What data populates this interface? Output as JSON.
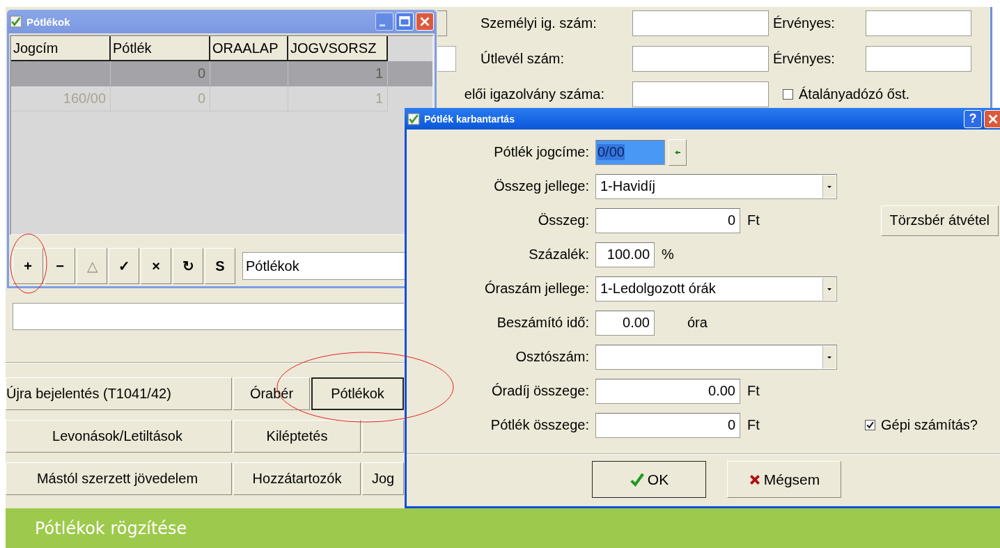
{
  "id_form": {
    "rows": [
      {
        "label": "Személyi ig. szám:",
        "validity_label": "Érvényes:"
      },
      {
        "label": "Útlevél szám:",
        "validity_label": "Érvényes:"
      }
    ],
    "card_label": "elői igazolvány száma:",
    "flat_rate": {
      "label": "Átalányadózó őst.",
      "checked": false
    }
  },
  "lower_buttons": [
    [
      {
        "label": "Újra bejelentés (T1041/42)",
        "kind": "button"
      },
      {
        "label": "Órabér",
        "kind": "button"
      },
      {
        "label": "Pótlékok",
        "kind": "default"
      }
    ],
    [
      {
        "label": "Levonások/Letiltások",
        "kind": "button"
      },
      {
        "label": "Kiléptetés",
        "kind": "button"
      },
      {
        "kind": "button"
      }
    ],
    [
      {
        "label": "Mástól szerzett jövedelem",
        "kind": "button"
      },
      {
        "label": "Hozzátartozók",
        "kind": "button"
      },
      {
        "label": "Jog",
        "kind": "button"
      }
    ]
  ],
  "list_window": {
    "title": "Pótlékok",
    "columns": [
      "Jogcím",
      "Pótlék",
      "ORAALAP",
      "JOGVSORSZ"
    ],
    "rows": [
      {
        "cells": [
          null,
          "0",
          null,
          "1"
        ],
        "selected": true
      },
      {
        "cells": [
          "160/00",
          "0",
          null,
          "1"
        ],
        "selected": false
      }
    ],
    "toolbar": [
      {
        "label": "+",
        "disabled": false
      },
      {
        "label": "−",
        "disabled": false
      },
      {
        "label": "△",
        "disabled": true
      },
      {
        "label": "✓",
        "disabled": false
      },
      {
        "label": "×",
        "disabled": false
      },
      {
        "label": "↻",
        "disabled": false
      },
      {
        "label": "S",
        "disabled": false
      }
    ],
    "filter_value": "Pótlékok"
  },
  "dialog": {
    "title": "Pótlék karbantartás",
    "help_label": "?",
    "rows": [
      {
        "label": "Pótlék jogcíme:",
        "kind": "code",
        "value": "0/00",
        "highlighted": true
      },
      {
        "label": "Összeg jellege:",
        "kind": "dropdown",
        "value": "1-Havidíj"
      },
      {
        "label": "Összeg:",
        "kind": "amount",
        "value": "0",
        "unit": "Ft",
        "button": "Törzsbér átvétel"
      },
      {
        "label": "Százalék:",
        "kind": "short",
        "value": "100.00",
        "unit": "%"
      },
      {
        "label": "Óraszám jellege:",
        "kind": "dropdown",
        "value": "1-Ledolgozott órák"
      },
      {
        "label": "Beszámító idő:",
        "kind": "hours",
        "value": "0.00",
        "unit": "óra"
      },
      {
        "label": "Osztószám:",
        "kind": "dropdown"
      },
      {
        "label": "Óradíj összege:",
        "kind": "amount",
        "value": "0.00",
        "unit": "Ft"
      },
      {
        "label": "Pótlék összege:",
        "kind": "amount",
        "value": "0",
        "unit": "Ft",
        "checkbox": {
          "label": "Gépi számítás?",
          "checked": true
        }
      }
    ],
    "ok": "OK",
    "cancel": "Mégsem"
  },
  "caption": "Pótlékok rögzítése"
}
